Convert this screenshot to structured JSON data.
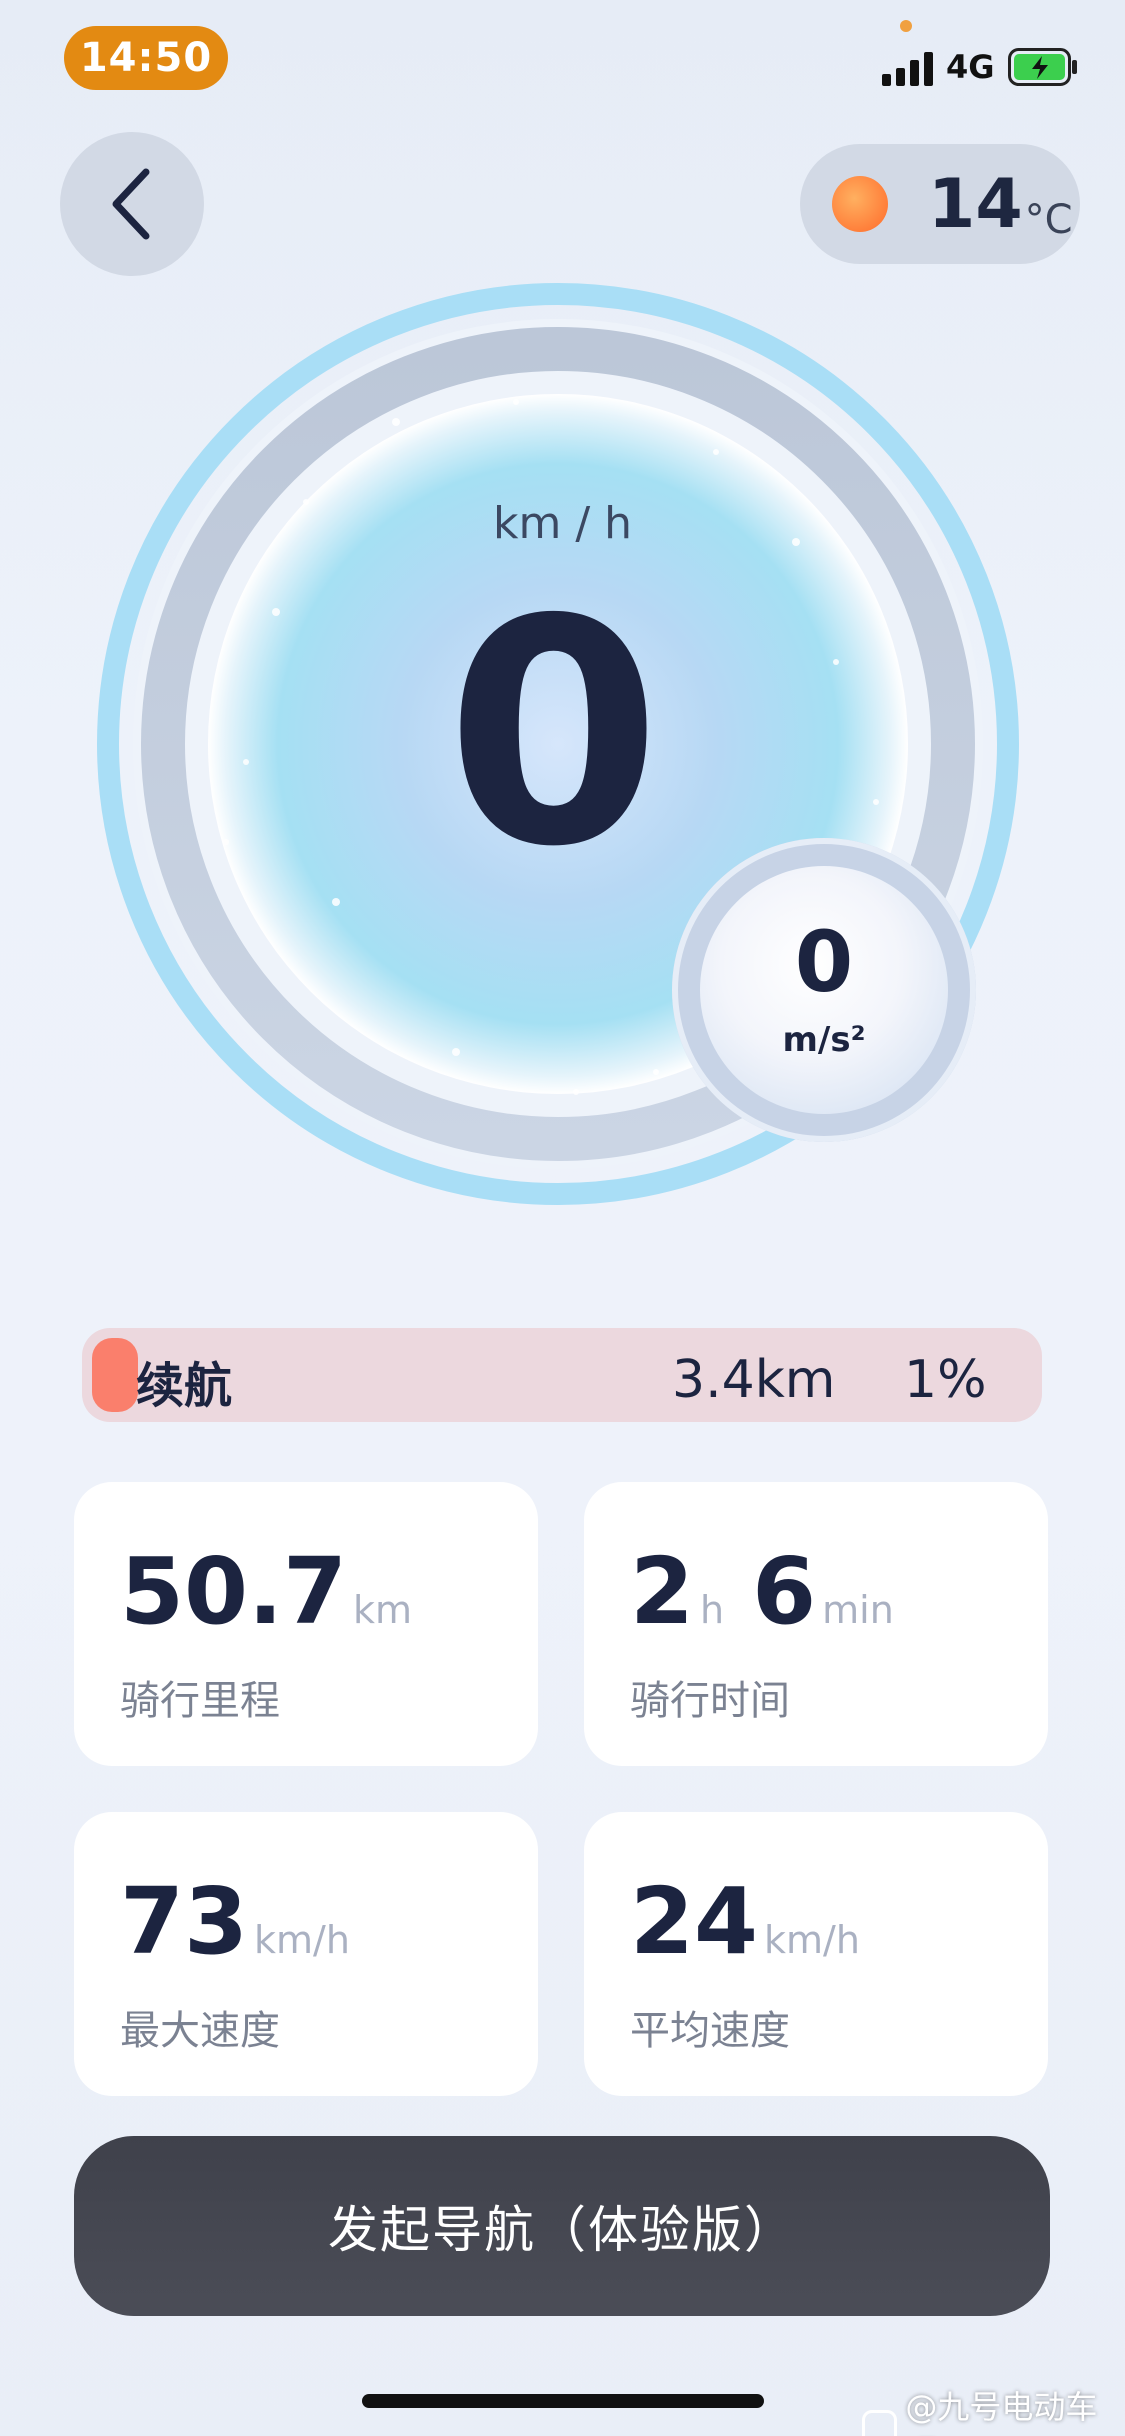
{
  "status_bar": {
    "time": "14:50",
    "network": "4G",
    "battery_state": "charging",
    "accent": "#e38a12"
  },
  "weather": {
    "icon": "sun-icon",
    "temperature": "14",
    "unit": "°C"
  },
  "speedometer": {
    "unit": "km / h",
    "speed": "0"
  },
  "acceleration": {
    "value": "0",
    "unit": "m/s²"
  },
  "range": {
    "label": "续航",
    "distance": "3.4km",
    "percent": "1%",
    "level_fraction": 0.01,
    "fill_color": "#fa7f6c"
  },
  "stats": [
    {
      "value": "50.7",
      "unit": "km",
      "label": "骑行里程"
    },
    {
      "hours": "2",
      "hours_unit": "h",
      "minutes": "6",
      "minutes_unit": "min",
      "label": "骑行时间"
    },
    {
      "value": "73",
      "unit": "km/h",
      "label": "最大速度"
    },
    {
      "value": "24",
      "unit": "km/h",
      "label": "平均速度"
    }
  ],
  "navigation_button": {
    "label": "发起导航（体验版）"
  },
  "watermark": {
    "text": "@九号电动车吧"
  }
}
